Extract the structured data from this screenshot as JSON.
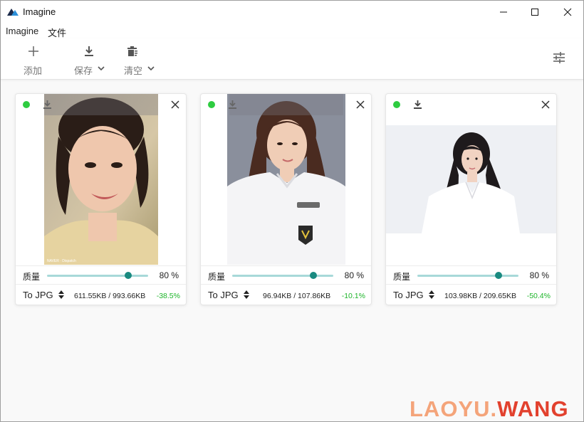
{
  "window": {
    "title": "Imagine",
    "controls": [
      "minimize-icon",
      "maximize-icon",
      "close-icon"
    ]
  },
  "menu": {
    "items": [
      "Imagine",
      "文件"
    ]
  },
  "toolbar": {
    "add_label": "添加",
    "save_label": "保存",
    "clear_label": "清空",
    "settings_icon": "sliders-icon"
  },
  "cards": [
    {
      "status": "ready",
      "quality_label": "质量",
      "quality": 80,
      "quality_text": "80 %",
      "format": "To JPG",
      "sizes": "611.55KB / 993.66KB",
      "change": "-38.5%"
    },
    {
      "status": "ready",
      "quality_label": "质量",
      "quality": 80,
      "quality_text": "80 %",
      "format": "To JPG",
      "sizes": "96.94KB / 107.86KB",
      "change": "-10.1%"
    },
    {
      "status": "ready",
      "quality_label": "质量",
      "quality": 80,
      "quality_text": "80 %",
      "format": "To JPG",
      "sizes": "103.98KB / 209.65KB",
      "change": "-50.4%"
    }
  ],
  "watermark": {
    "text": "LAOYU.WANG",
    "part1": "LAOYU.",
    "part2": "WANG"
  },
  "colors": {
    "accent": "#1a8a80",
    "slider_track": "#a7d9d9",
    "status_dot": "#2ecc40",
    "savings": "#1eb52a"
  }
}
